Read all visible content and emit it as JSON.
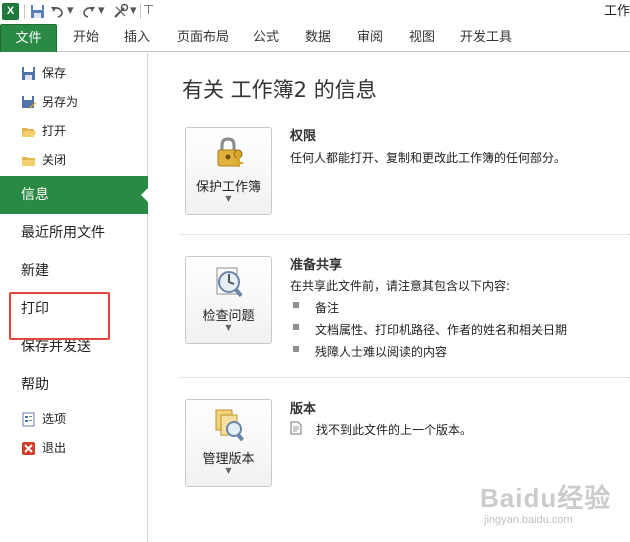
{
  "window": {
    "title": "工作"
  },
  "quick_access": {
    "logo": "X",
    "icons": [
      "save-icon",
      "undo-icon",
      "redo-icon",
      "customize-icon"
    ]
  },
  "ribbon_tabs": [
    {
      "label": "文件",
      "active": true
    },
    {
      "label": "开始"
    },
    {
      "label": "插入"
    },
    {
      "label": "页面布局"
    },
    {
      "label": "公式"
    },
    {
      "label": "数据"
    },
    {
      "label": "审阅"
    },
    {
      "label": "视图"
    },
    {
      "label": "开发工具"
    }
  ],
  "nav": {
    "save": "保存",
    "save_as": "另存为",
    "open": "打开",
    "close": "关闭",
    "info": "信息",
    "recent": "最近所用文件",
    "new": "新建",
    "print": "打印",
    "save_send": "保存并发送",
    "help": "帮助",
    "options": "选项",
    "exit": "退出"
  },
  "main": {
    "title": "有关 工作簿2 的信息",
    "sections": [
      {
        "button_label": "保护工作簿",
        "button_icon": "lock-key-icon",
        "heading": "权限",
        "text": "任何人都能打开、复制和更改此工作簿的任何部分。"
      },
      {
        "button_label": "检查问题",
        "button_icon": "inspect-icon",
        "heading": "准备共享",
        "text": "在共享此文件前，请注意其包含以下内容:",
        "bullets": [
          "备注",
          "文档属性、打印机路径、作者的姓名和相关日期",
          "残障人士难以阅读的内容"
        ]
      },
      {
        "button_label": "管理版本",
        "button_icon": "manage-versions-icon",
        "heading": "版本",
        "text": "找不到此文件的上一个版本。"
      }
    ]
  },
  "watermark": {
    "logo": "Baidu经验",
    "url": "jingyan.baidu.com"
  },
  "colors": {
    "file_green": "#2a8a43",
    "highlight_red": "#e4463a"
  }
}
